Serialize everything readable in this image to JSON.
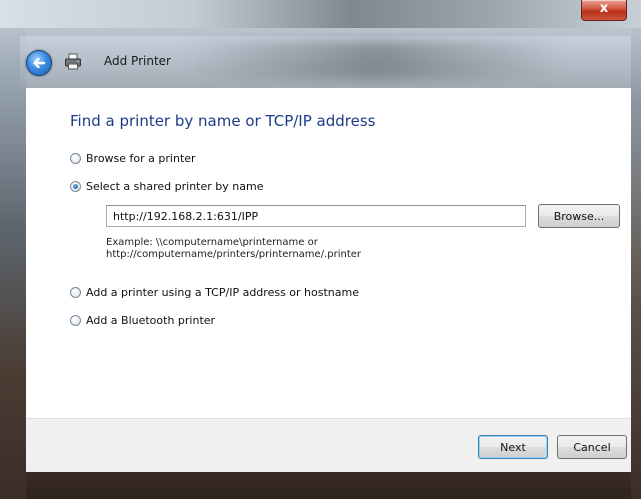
{
  "window": {
    "title": "Add Printer",
    "close_glyph": "x"
  },
  "icons": {
    "back": "back-arrow-icon",
    "printer": "printer-icon"
  },
  "wizard": {
    "heading": "Find a printer by name or TCP/IP address",
    "options": [
      {
        "label": "Browse for a printer",
        "checked": false
      },
      {
        "label": "Select a shared printer by name",
        "checked": true
      },
      {
        "label": "Add a printer using a TCP/IP address or hostname",
        "checked": false
      },
      {
        "label": "Add a Bluetooth printer",
        "checked": false
      }
    ],
    "shared_printer_value": "http://192.168.2.1:631/IPP",
    "browse_label": "Browse...",
    "example_line1": "Example: \\\\computername\\printername or",
    "example_line2": "http://computername/printers/printername/.printer"
  },
  "footer": {
    "next_label": "Next",
    "cancel_label": "Cancel"
  },
  "colors": {
    "heading": "#1c3c88",
    "close_button": "#c9412a",
    "default_button_border": "#3c7fb1"
  }
}
